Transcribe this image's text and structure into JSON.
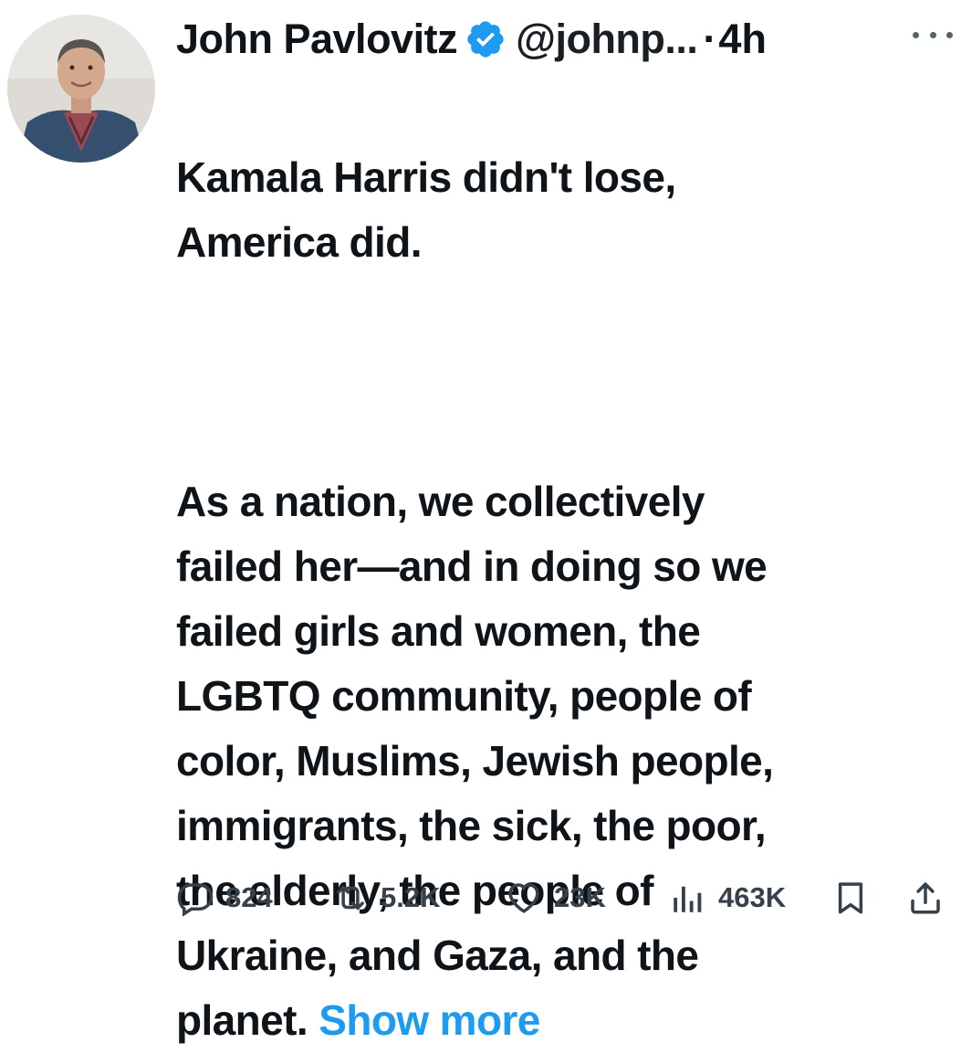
{
  "post": {
    "author_name": "John Pavlovitz",
    "handle": "@johnp...",
    "separator": "·",
    "time": "4h",
    "text_line_1": "Kamala Harris didn't lose,\nAmerica did.",
    "text_line_2": "As a nation, we collectively\nfailed her—and in doing so we\nfailed girls and women, the\nLGBTQ community, people of\ncolor, Muslims, Jewish people,\nimmigrants, the sick, the poor,\nthe elderly, the people of\nUkraine, and Gaza, and the\nplanet. ",
    "show_more": "Show more"
  },
  "actions": {
    "replies": "824",
    "reposts": "5.2K",
    "likes": "23K",
    "views": "463K"
  },
  "icons": {
    "verified": "verified-badge-icon",
    "more": "more-dots-icon",
    "reply": "reply-icon",
    "repost": "repost-icon",
    "like": "heart-icon",
    "views": "views-chart-icon",
    "bookmark": "bookmark-icon",
    "share": "share-icon"
  },
  "colors": {
    "accent": "#1d9bf0",
    "text": "#0f1419",
    "muted": "#536471"
  }
}
